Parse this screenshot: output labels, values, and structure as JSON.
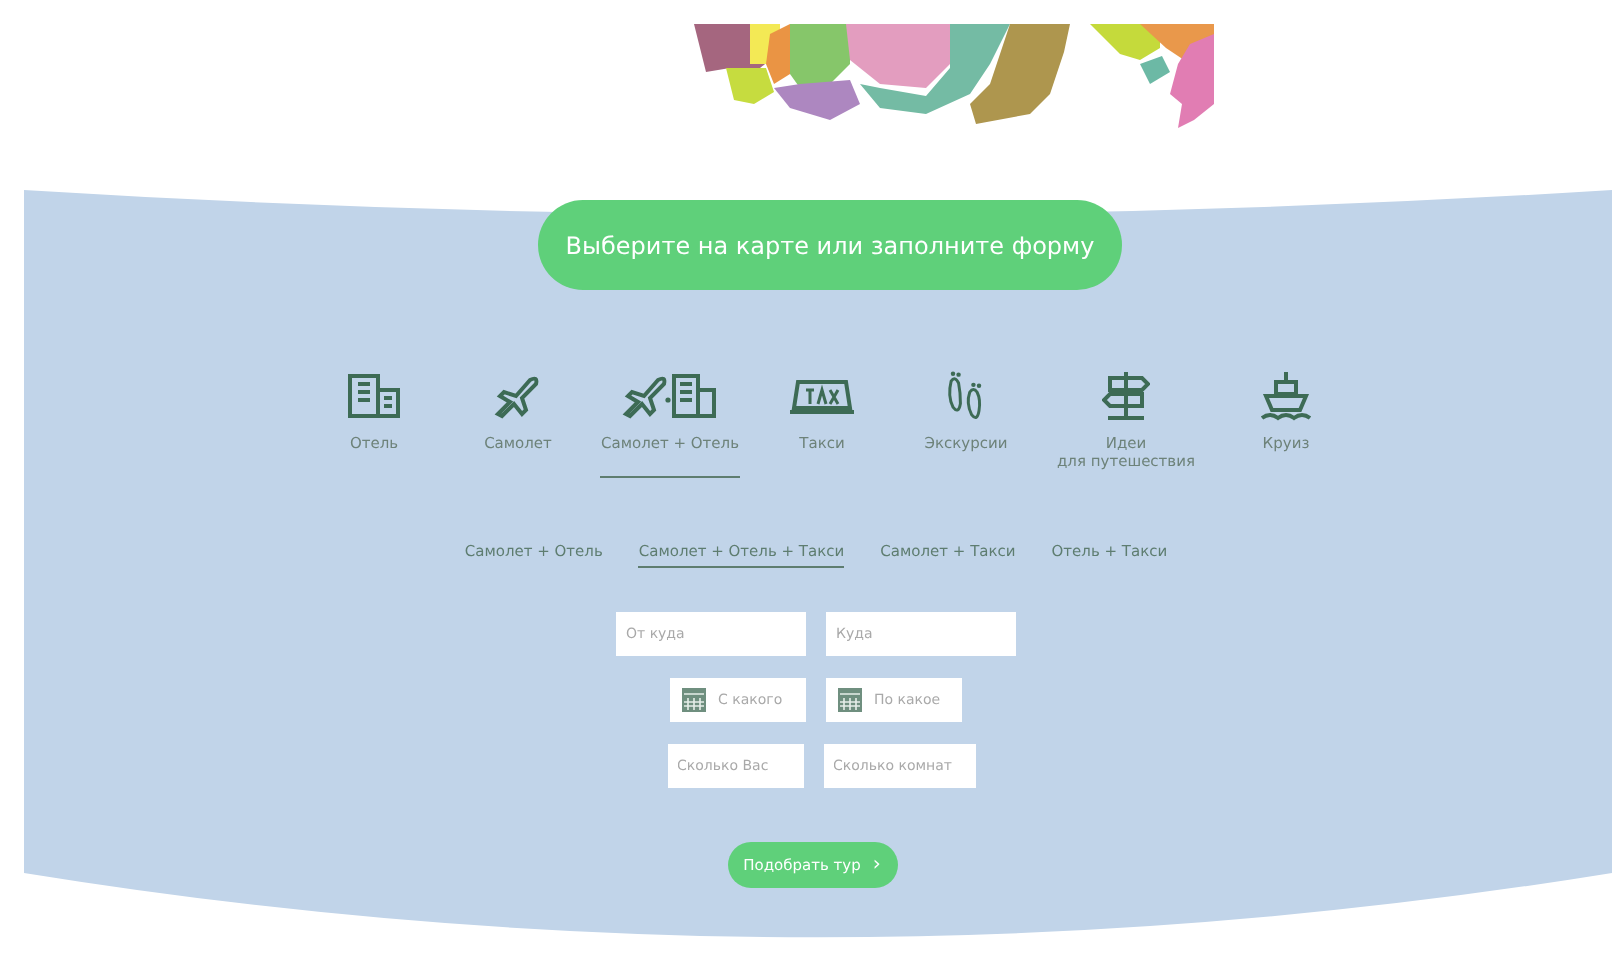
{
  "banner_button": "Выберите на карте или заполните форму",
  "categories": [
    {
      "kind": "hotel",
      "label": "Отель",
      "selected": false
    },
    {
      "kind": "plane",
      "label": "Самолет",
      "selected": false
    },
    {
      "kind": "plane-hotel",
      "label": "Самолет + Отель",
      "selected": true
    },
    {
      "kind": "taxi",
      "label": "Такси",
      "selected": false
    },
    {
      "kind": "excursion",
      "label": "Экскурсии",
      "selected": false
    },
    {
      "kind": "ideas",
      "label": "Идеи\nдля путешествия",
      "selected": false
    },
    {
      "kind": "cruise",
      "label": "Круиз",
      "selected": false
    }
  ],
  "subtabs": [
    {
      "label": "Самолет + Отель",
      "selected": false
    },
    {
      "label": "Самолет + Отель + Такси",
      "selected": true
    },
    {
      "label": "Самолет + Такси",
      "selected": false
    },
    {
      "label": "Отель + Такси",
      "selected": false
    }
  ],
  "fields": [
    [
      {
        "placeholder": "От куда",
        "kind": "text"
      },
      {
        "placeholder": "Куда",
        "kind": "text"
      }
    ],
    [
      {
        "placeholder": "С какого",
        "kind": "date"
      },
      {
        "placeholder": "По какое",
        "kind": "date"
      }
    ],
    [
      {
        "placeholder": "Сколько Вас",
        "kind": "text"
      },
      {
        "placeholder": "Сколько комнат",
        "kind": "text"
      }
    ]
  ],
  "submit": {
    "label": "Подобрать тур",
    "icon": "›"
  }
}
